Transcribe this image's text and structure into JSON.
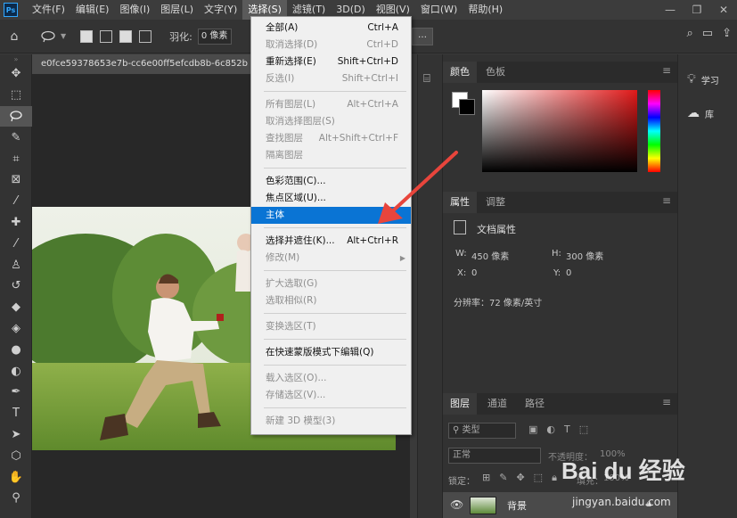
{
  "app": {
    "logo": "Ps"
  },
  "menubar": {
    "items": [
      "文件(F)",
      "编辑(E)",
      "图像(I)",
      "图层(L)",
      "文字(Y)",
      "选择(S)",
      "滤镜(T)",
      "3D(D)",
      "视图(V)",
      "窗口(W)",
      "帮助(H)"
    ],
    "active_index": 5
  },
  "window_controls": {
    "minimize": "—",
    "restore": "❐",
    "close": "✕"
  },
  "options_bar": {
    "feather_label": "羽化:",
    "feather_value": "0 像素",
    "select_mask_label": "…"
  },
  "document": {
    "tab_title": "e0fce59378653e7b-cc6e00ff5efcdb8b-6c852b"
  },
  "select_menu": {
    "items": [
      {
        "label": "全部(A)",
        "shortcut": "Ctrl+A",
        "enabled": true
      },
      {
        "label": "取消选择(D)",
        "shortcut": "Ctrl+D",
        "enabled": false
      },
      {
        "label": "重新选择(E)",
        "shortcut": "Shift+Ctrl+D",
        "enabled": true
      },
      {
        "label": "反选(I)",
        "shortcut": "Shift+Ctrl+I",
        "enabled": false
      },
      {
        "label": "所有图层(L)",
        "shortcut": "Alt+Ctrl+A",
        "enabled": false
      },
      {
        "label": "取消选择图层(S)",
        "shortcut": "",
        "enabled": false
      },
      {
        "label": "查找图层",
        "shortcut": "Alt+Shift+Ctrl+F",
        "enabled": false
      },
      {
        "label": "隔离图层",
        "shortcut": "",
        "enabled": false
      },
      {
        "label": "色彩范围(C)...",
        "shortcut": "",
        "enabled": true
      },
      {
        "label": "焦点区域(U)...",
        "shortcut": "",
        "enabled": true
      },
      {
        "label": "主体",
        "shortcut": "",
        "enabled": true,
        "highlighted": true
      },
      {
        "label": "选择并遮住(K)...",
        "shortcut": "Alt+Ctrl+R",
        "enabled": true
      },
      {
        "label": "修改(M)",
        "shortcut": "",
        "enabled": false,
        "submenu": true
      },
      {
        "label": "扩大选取(G)",
        "shortcut": "",
        "enabled": false
      },
      {
        "label": "选取相似(R)",
        "shortcut": "",
        "enabled": false
      },
      {
        "label": "变换选区(T)",
        "shortcut": "",
        "enabled": false
      },
      {
        "label": "在快速蒙版模式下编辑(Q)",
        "shortcut": "",
        "enabled": true
      },
      {
        "label": "载入选区(O)...",
        "shortcut": "",
        "enabled": false
      },
      {
        "label": "存储选区(V)...",
        "shortcut": "",
        "enabled": false
      },
      {
        "label": "新建 3D 模型(3)",
        "shortcut": "",
        "enabled": false
      }
    ]
  },
  "color_panel": {
    "tabs": [
      "颜色",
      "色板"
    ],
    "foreground": "#ffffff",
    "background": "#000000",
    "hue_color": "#e11919"
  },
  "properties_panel": {
    "tabs": [
      "属性",
      "调整"
    ],
    "section_title": "文档属性",
    "width_label": "W:",
    "width_value": "450 像素",
    "height_label": "H:",
    "height_value": "300 像素",
    "x_label": "X:",
    "x_value": "0",
    "y_label": "Y:",
    "y_value": "0",
    "resolution": "分辨率：72 像素/英寸"
  },
  "layers_panel": {
    "tabs": [
      "图层",
      "通道",
      "路径"
    ],
    "filter_label": "类型",
    "blend_mode": "正常",
    "opacity_label": "不透明度：",
    "opacity_value": "100%",
    "lock_label": "锁定：",
    "fill_label": "填充：",
    "fill_value": "100%",
    "layer_name": "背景"
  },
  "right_dock": {
    "learn_label": "学习",
    "libraries_label": "库"
  },
  "watermark": {
    "brand": "Bai du 经验",
    "url": "jingyan.baidu.com"
  },
  "accent_colors": {
    "highlight": "#0a74d4",
    "arrow": "#e8453c"
  }
}
